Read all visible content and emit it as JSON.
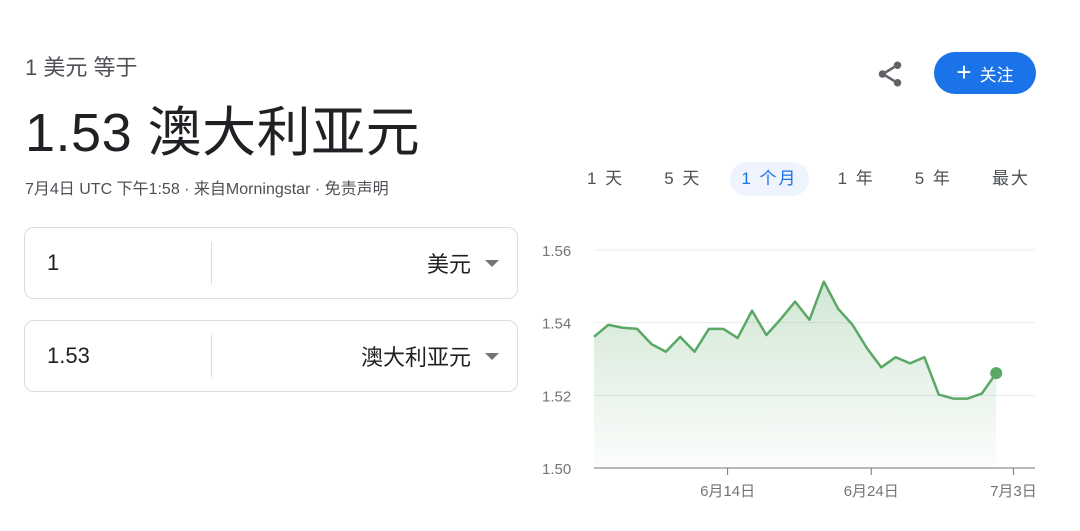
{
  "header": {
    "subtitle": "1 美元 等于",
    "result": "1.53 澳大利亚元",
    "meta": "7月4日 UTC 下午1:58 · 来自Morningstar · 免责声明",
    "follow_label": "关注"
  },
  "converter": {
    "from": {
      "value": "1",
      "currency": "美元"
    },
    "to": {
      "value": "1.53",
      "currency": "澳大利亚元"
    }
  },
  "range_tabs": [
    "1 天",
    "5 天",
    "1 个月",
    "1 年",
    "5 年",
    "最大"
  ],
  "active_tab": "1 个月",
  "colors": {
    "accent": "#1a73e8",
    "line": "#5aa865",
    "fill": "#e6f4ea"
  },
  "chart_data": {
    "type": "line",
    "ylim": [
      1.5,
      1.56
    ],
    "yticks": [
      1.56,
      1.54,
      1.52,
      1.5
    ],
    "xtick_labels": [
      {
        "label": "6月14日",
        "x": 9.3
      },
      {
        "label": "6月24日",
        "x": 19.3
      },
      {
        "label": "7月3日",
        "x": 29.2
      }
    ],
    "xlim": [
      0,
      30.7
    ],
    "points": [
      [
        0,
        1.5361
      ],
      [
        1,
        1.5394
      ],
      [
        2,
        1.5386
      ],
      [
        3,
        1.5383
      ],
      [
        4,
        1.5341
      ],
      [
        5,
        1.532
      ],
      [
        6,
        1.5361
      ],
      [
        7,
        1.532
      ],
      [
        8,
        1.5383
      ],
      [
        9,
        1.5383
      ],
      [
        10,
        1.5358
      ],
      [
        11,
        1.5433
      ],
      [
        12,
        1.5366
      ],
      [
        13,
        1.541
      ],
      [
        14,
        1.5458
      ],
      [
        15,
        1.5408
      ],
      [
        16,
        1.5513
      ],
      [
        17,
        1.5438
      ],
      [
        18,
        1.5394
      ],
      [
        19,
        1.533
      ],
      [
        20,
        1.5277
      ],
      [
        21,
        1.5305
      ],
      [
        22,
        1.5288
      ],
      [
        23,
        1.5305
      ],
      [
        24,
        1.5202
      ],
      [
        25,
        1.5191
      ],
      [
        26,
        1.5191
      ],
      [
        27,
        1.5205
      ],
      [
        28,
        1.5261
      ]
    ],
    "end_dot": true
  }
}
